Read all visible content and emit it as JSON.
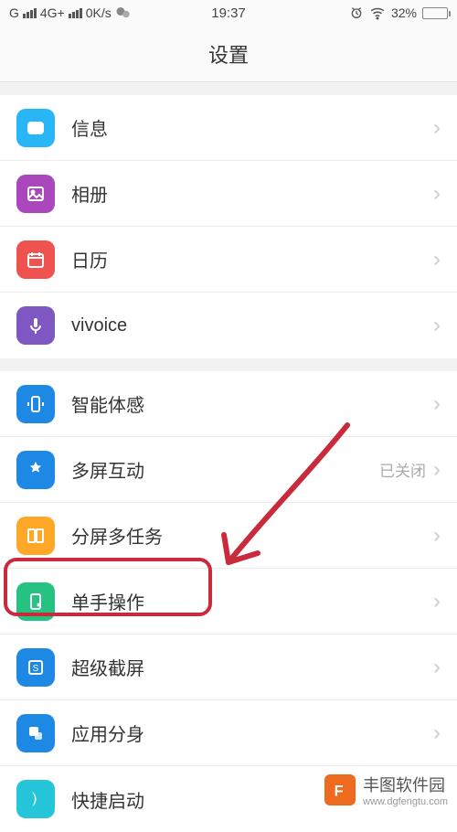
{
  "status": {
    "carrier_prefix": "G",
    "network": "4G+",
    "speed": "0K/s",
    "time": "19:37",
    "battery_pct": "32%",
    "battery_fill": 32
  },
  "header": {
    "title": "设置"
  },
  "group1": [
    {
      "label": "信息",
      "icon_name": "message-icon",
      "bg": "#29b6f6"
    },
    {
      "label": "相册",
      "icon_name": "gallery-icon",
      "bg": "#ab47bc"
    },
    {
      "label": "日历",
      "icon_name": "calendar-icon",
      "bg": "#ef5350"
    },
    {
      "label": "vivoice",
      "icon_name": "voice-icon",
      "bg": "#7e57c2"
    }
  ],
  "group2": [
    {
      "label": "智能体感",
      "icon_name": "smart-sense-icon",
      "bg": "#1e88e5",
      "value": null
    },
    {
      "label": "多屏互动",
      "icon_name": "multiscreen-icon",
      "bg": "#1e88e5",
      "value": "已关闭"
    },
    {
      "label": "分屏多任务",
      "icon_name": "splitscreen-icon",
      "bg": "#ffa726",
      "value": null
    },
    {
      "label": "单手操作",
      "icon_name": "onehand-icon",
      "bg": "#26c281",
      "value": null
    },
    {
      "label": "超级截屏",
      "icon_name": "screenshot-icon",
      "bg": "#1e88e5",
      "value": null
    },
    {
      "label": "应用分身",
      "icon_name": "appclone-icon",
      "bg": "#1e88e5",
      "value": null
    },
    {
      "label": "快捷启动",
      "icon_name": "quickstart-icon",
      "bg": "#26c6da",
      "value": null
    }
  ],
  "annotation": {
    "highlight_target": "单手操作"
  },
  "watermark": {
    "title": "丰图软件园",
    "url": "www.dgfengtu.com",
    "logo_letter": "F"
  }
}
